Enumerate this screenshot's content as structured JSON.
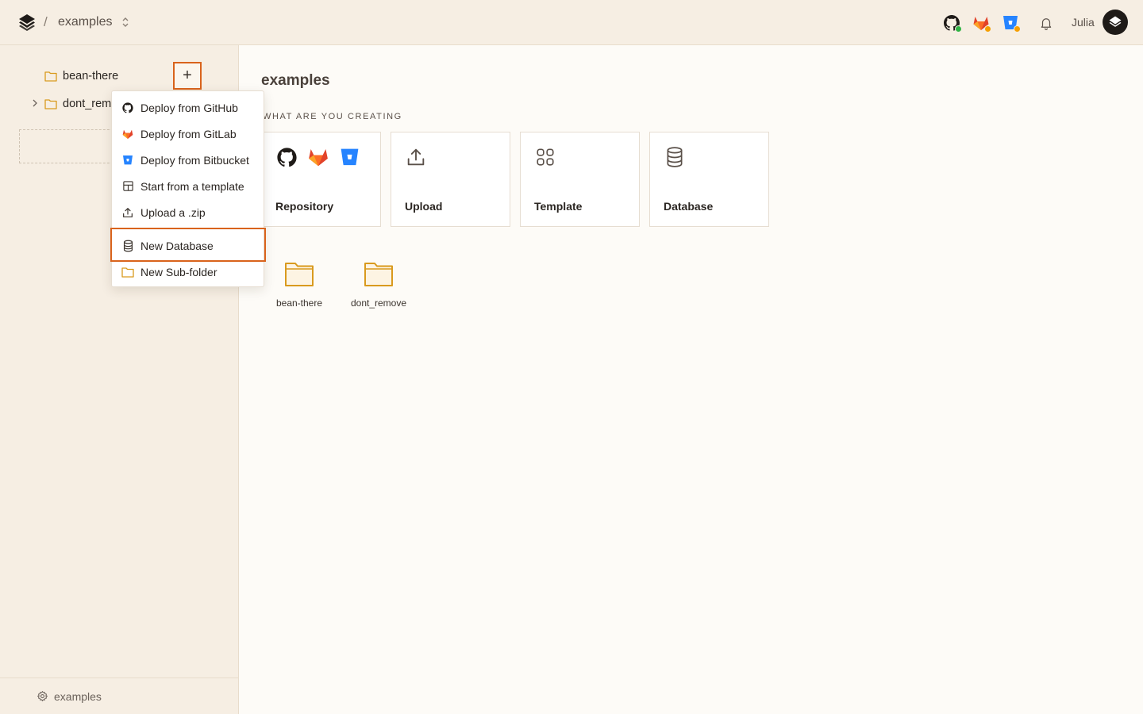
{
  "header": {
    "breadcrumb_separator": "/",
    "workspace": "examples",
    "user_name": "Julia",
    "accent": "#d9631c"
  },
  "sidebar": {
    "folders": [
      {
        "label": "bean-there"
      },
      {
        "label": "dont_rem"
      }
    ],
    "add_label": "+",
    "new_project_label": "+",
    "footer_label": "examples"
  },
  "dropdown": {
    "items": [
      {
        "label": "Deploy from GitHub",
        "icon": "github-icon"
      },
      {
        "label": "Deploy from GitLab",
        "icon": "gitlab-icon"
      },
      {
        "label": "Deploy from Bitbucket",
        "icon": "bitbucket-icon"
      },
      {
        "label": "Start from a template",
        "icon": "template-icon"
      },
      {
        "label": "Upload a .zip",
        "icon": "upload-icon"
      },
      {
        "label": "New Database",
        "icon": "database-icon"
      },
      {
        "label": "New Sub-folder",
        "icon": "folder-icon"
      }
    ]
  },
  "main": {
    "title": "examples",
    "section_label": "WHAT ARE YOU CREATING",
    "cards": [
      {
        "label": "Repository"
      },
      {
        "label": "Upload"
      },
      {
        "label": "Template"
      },
      {
        "label": "Database"
      }
    ],
    "folders": [
      {
        "label": "bean-there"
      },
      {
        "label": "dont_remove"
      }
    ]
  }
}
